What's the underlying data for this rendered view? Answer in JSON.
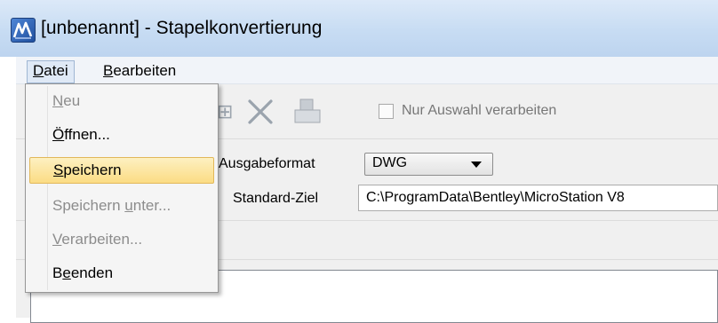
{
  "window": {
    "title": "[unbenannt] - Stapelkonvertierung",
    "icon": "microstation-app-icon"
  },
  "menubar": {
    "datei": {
      "mnemonic": "D",
      "rest": "atei"
    },
    "bearbeiten": {
      "mnemonic": "B",
      "rest": "earbeiten"
    }
  },
  "datei_menu": {
    "items": [
      {
        "pre": "",
        "mnemonic": "N",
        "post": "eu",
        "state": "disabled"
      },
      {
        "pre": "",
        "mnemonic": "Ö",
        "post": "ffnen...",
        "state": "enabled"
      },
      {
        "pre": "",
        "mnemonic": "S",
        "post": "peichern",
        "state": "highlighted"
      },
      {
        "pre": "Speichern ",
        "mnemonic": "u",
        "post": "nter...",
        "state": "disabled"
      },
      {
        "pre": "",
        "mnemonic": "V",
        "post": "erarbeiten...",
        "state": "disabled"
      },
      {
        "pre": "B",
        "mnemonic": "e",
        "post": "enden",
        "state": "enabled"
      }
    ]
  },
  "toolbar": {
    "icons": [
      "add-icon",
      "delete-icon",
      "process-icon"
    ],
    "only_selection_label": "Nur Auswahl verarbeiten",
    "only_selection_checked": false
  },
  "settings": {
    "output_format_label": "Ausgabeformat",
    "output_format_value": "DWG",
    "default_target_label": "Standard-Ziel",
    "default_target_value": "C:\\ProgramData\\Bentley\\MicroStation V8"
  }
}
